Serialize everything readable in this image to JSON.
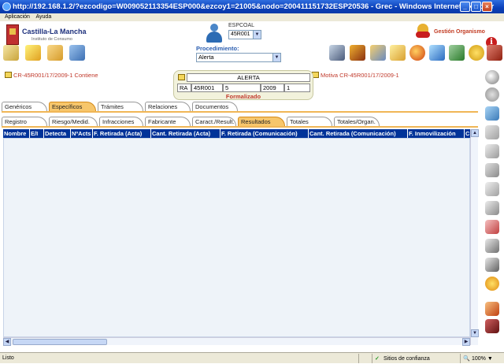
{
  "window": {
    "title": "http://192.168.1.2/?ezcodigo=W009052113354ESP000&ezcoy1=21005&nodo=200411151732ESP20536 - Grec - Windows Internet Explorer"
  },
  "menu": {
    "items": [
      "Aplicación",
      "Ayuda"
    ]
  },
  "header": {
    "logo_title": "Castilla-La Mancha",
    "logo_subtitle": "Instituto de Consumo",
    "user_name": "ESPCOAL",
    "user_office": "45R001",
    "org_label": "Gestión Organismo",
    "proc_label": "Procedimiento:",
    "proc_value": "Alerta"
  },
  "record": {
    "left_link": "CR-45R001/17/2009-1 Contiene",
    "right_link": "Motiva CR-45R001/17/2009-1",
    "alert_title": "ALERTA",
    "code": "RA",
    "office": "45R001",
    "number": "5",
    "year": "2009",
    "seq": "1",
    "status": "Formalizado"
  },
  "tabs_row1": [
    "Genéricos",
    "Específicos",
    "Trámites",
    "Relaciones",
    "Documentos"
  ],
  "tabs_row2": [
    "Registro",
    "Riesgo/Medid.",
    "Infracciones",
    "Fabricante",
    "Caract./Result.",
    "Resultados",
    "Totales",
    "Totales/Organ."
  ],
  "grid": {
    "columns": [
      "Nombre",
      "E/I",
      "Detecta",
      "NºActs",
      "F. Retirada (Acta)",
      "Cant. Retirada (Acta)",
      "F. Retirada (Comunicación)",
      "Cant. Retirada (Comunicación)",
      "F. Inmovilización",
      "C"
    ]
  },
  "status": {
    "left": "Listo",
    "zone": "Sitios de confianza",
    "zoom": "100%"
  },
  "colors": {
    "accent": "#f7c66b",
    "grid_header": "#003399",
    "link_red": "#c0392b"
  },
  "icons": {
    "toolbar_left": [
      "clipboard-icon",
      "folder-star-icon",
      "folder-icon",
      "cards-icon"
    ],
    "toolbar_right": [
      "laptop-icon",
      "books-icon",
      "network-icon",
      "chart-icon",
      "globe-icon",
      "search-icon",
      "tools-icon",
      "gear-icon",
      "exit-icon"
    ],
    "right_sidebar": [
      "magnify-icon",
      "back-icon",
      "forward-icon",
      "layers-icon",
      "pages-icon",
      "stack-icon",
      "copy-icon",
      "print-icon",
      "clip-icon",
      "printer-icon",
      "font-icon",
      "star-icon",
      "delete-icon",
      "car-icon"
    ]
  }
}
